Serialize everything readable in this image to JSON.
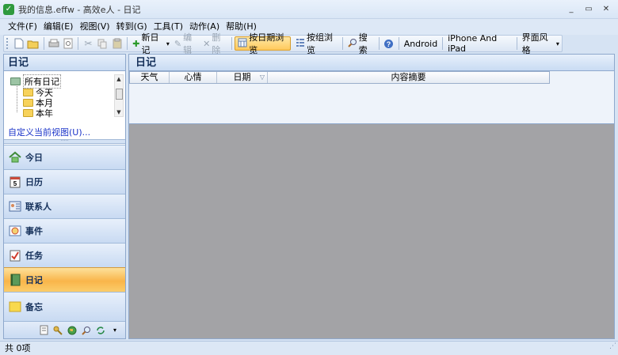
{
  "window": {
    "title": "我的信息.effw - 高效e人 - 日记",
    "app_icon_letter": "✓",
    "controls": [
      "_",
      "▭",
      "✕"
    ]
  },
  "menu": [
    {
      "label": "文件(F)"
    },
    {
      "label": "编辑(E)"
    },
    {
      "label": "视图(V)"
    },
    {
      "label": "转到(G)"
    },
    {
      "label": "工具(T)"
    },
    {
      "label": "动作(A)"
    },
    {
      "label": "帮助(H)"
    }
  ],
  "toolbar": {
    "new_diary": "新日记",
    "edit": "编辑",
    "delete": "删除",
    "browse_by_date": "按日期浏览",
    "browse_by_group": "按组浏览",
    "search": "搜索",
    "android": "Android",
    "iphone": "iPhone And iPad",
    "ui_style": "界面风格"
  },
  "left_pane": {
    "title": "日记",
    "tree": {
      "root": "所有日记",
      "children": [
        "今天",
        "本月",
        "本年"
      ]
    },
    "custom_view_link": "自定义当前视图(U)...",
    "nav": [
      {
        "label": "今日",
        "icon": "home-icon",
        "glyph": "🏠"
      },
      {
        "label": "日历",
        "icon": "calendar-icon",
        "glyph": "5"
      },
      {
        "label": "联系人",
        "icon": "contacts-icon",
        "glyph": "👤"
      },
      {
        "label": "事件",
        "icon": "event-icon",
        "glyph": "⏰"
      },
      {
        "label": "任务",
        "icon": "task-icon",
        "glyph": "✔"
      },
      {
        "label": "日记",
        "icon": "diary-icon",
        "glyph": "📗"
      },
      {
        "label": "备忘",
        "icon": "memo-icon",
        "glyph": "📒"
      }
    ],
    "selected_nav": "日记"
  },
  "right_pane": {
    "title": "日记",
    "columns": [
      "天气",
      "心情",
      "日期",
      "内容摘要"
    ]
  },
  "status": {
    "text": "共 0项"
  }
}
